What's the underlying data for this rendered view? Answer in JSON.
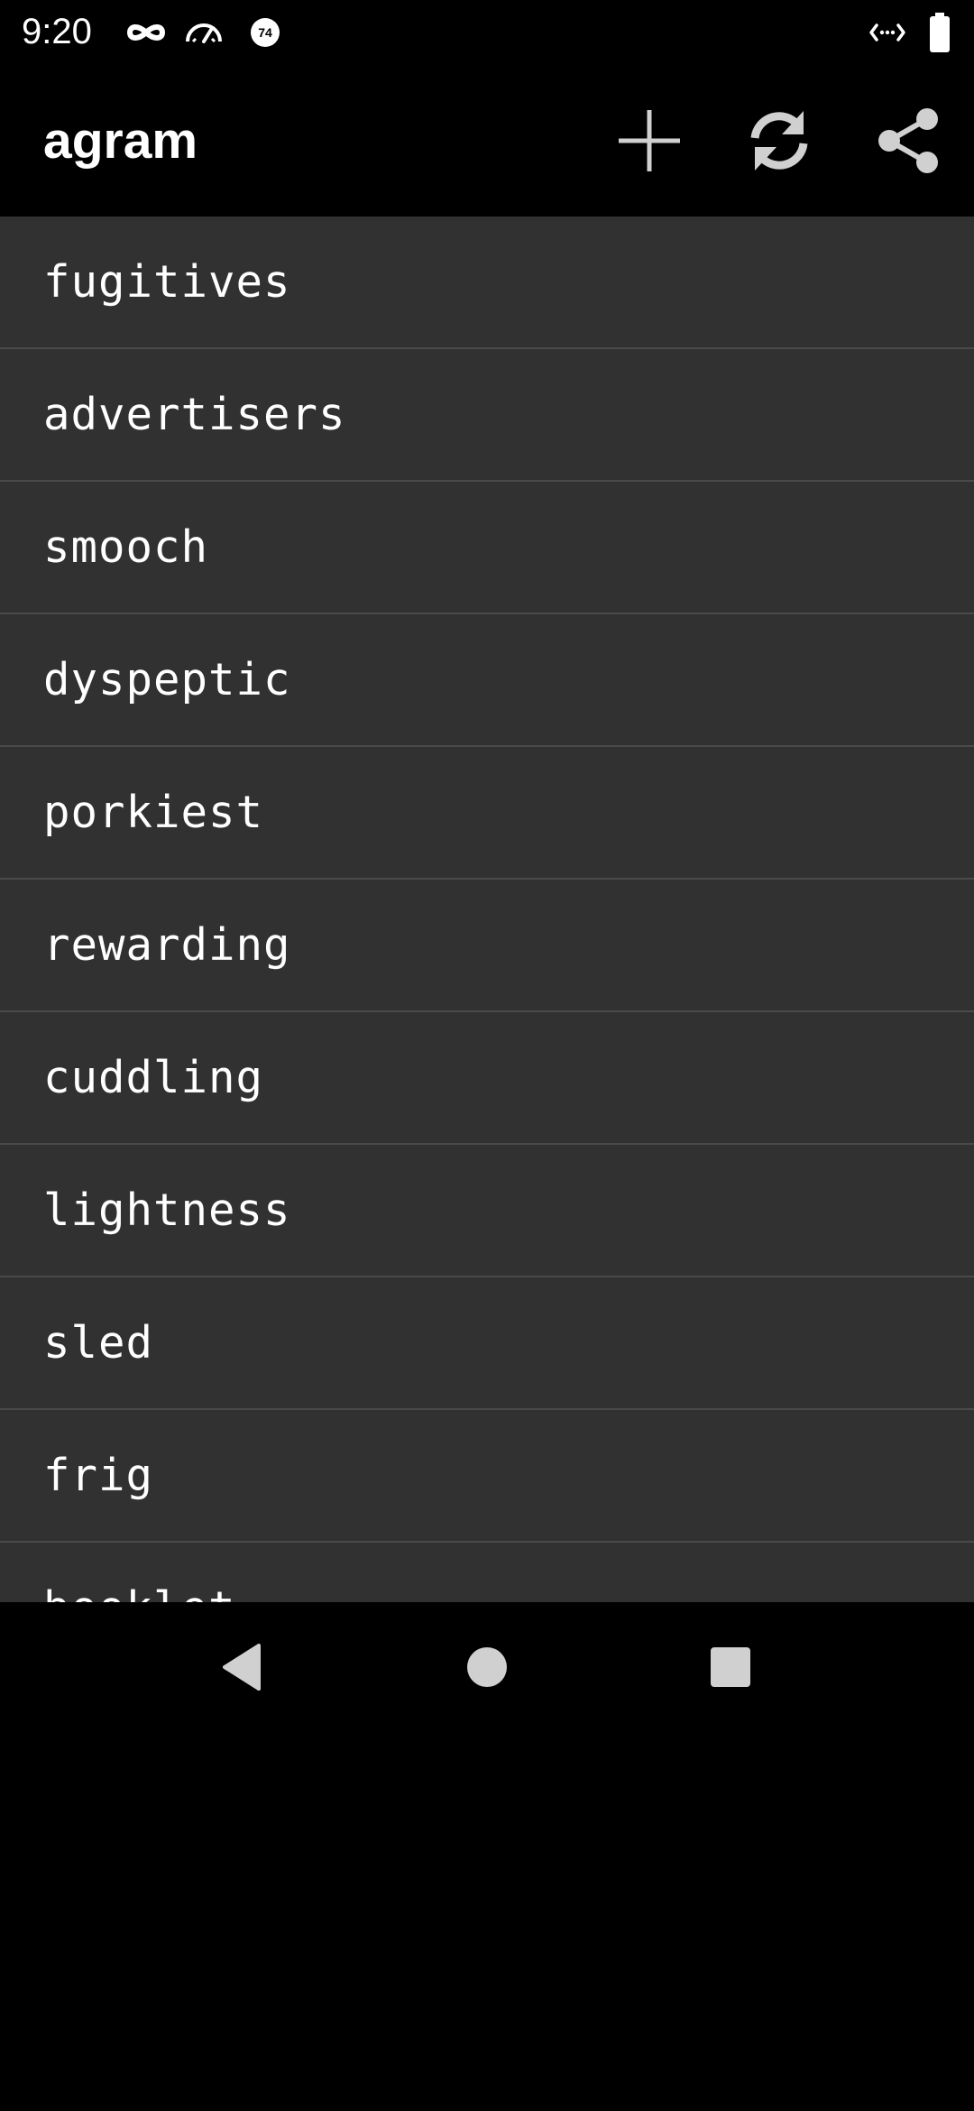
{
  "status_bar": {
    "time": "9:20",
    "icons": [
      "incognito-icon",
      "speedometer-icon",
      "notification-count-icon",
      "data-transfer-icon",
      "battery-icon"
    ],
    "notification_count": "74"
  },
  "app_bar": {
    "title": "agram",
    "actions": [
      "add-icon",
      "refresh-icon",
      "share-icon"
    ]
  },
  "words": [
    {
      "text": "fugitives"
    },
    {
      "text": "advertisers"
    },
    {
      "text": "smooch"
    },
    {
      "text": "dyspeptic"
    },
    {
      "text": "porkiest"
    },
    {
      "text": "rewarding"
    },
    {
      "text": "cuddling"
    },
    {
      "text": "lightness"
    },
    {
      "text": "sled"
    },
    {
      "text": "frig"
    },
    {
      "text": "booklet"
    }
  ],
  "nav_bar": {
    "buttons": [
      "back-icon",
      "home-icon",
      "recents-icon"
    ]
  },
  "colors": {
    "background": "#000000",
    "list_background": "#313131",
    "divider": "#4a4a4a",
    "icon": "#d0d0d0",
    "text": "#ffffff"
  }
}
